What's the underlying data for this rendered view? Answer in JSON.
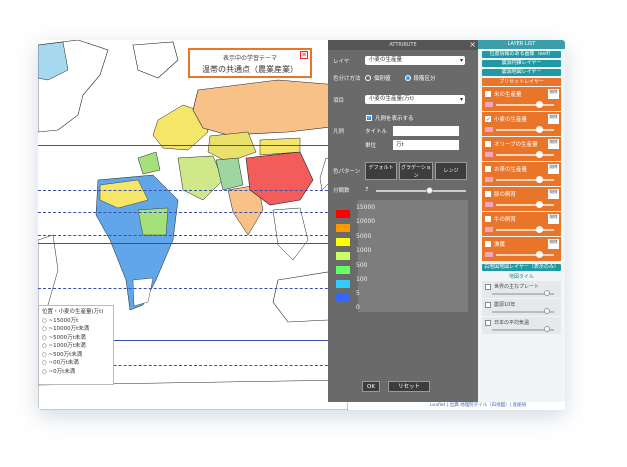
{
  "theme": {
    "heading": "表示中の学習テーマ",
    "title": "温帯の共通点（農業産業）",
    "close_label": "✕"
  },
  "legend_box": {
    "lines": [
      "位置・小麦の生産量(万t)",
      "○ ~15000万t",
      "○ ~10000万t未満",
      "○ ~5000万t未満",
      "○ ~1000万t未満",
      "○ ~500万t未満",
      "○ ~00万t未満",
      "○ ~0万t未満"
    ]
  },
  "settings": {
    "header": "ATTRIBUTE",
    "layer_label": "レイヤ",
    "layer_value": "小麦の生産量",
    "color_method_label": "色分け方法",
    "radio_a": "個別値",
    "radio_b": "段階区分",
    "item_label": "項目",
    "item_value": "小麦の生産量(万t)",
    "legend_check": "凡例を表示する",
    "legend_label": "凡例",
    "title_label": "タイトル",
    "unit_label": "単位",
    "unit_value": "万t",
    "pattern_label": "色パターン",
    "pattern_buttons": [
      "デフォルト",
      "グラデーション",
      "レンジ"
    ],
    "classes_label": "分類数",
    "classes_value": "7",
    "breaks": [
      {
        "color": "#ff0000",
        "value": "15000"
      },
      {
        "color": "#ff9900",
        "value": "10000"
      },
      {
        "color": "#ffff00",
        "value": "5000"
      },
      {
        "color": "#ccff66",
        "value": "1000"
      },
      {
        "color": "#66ff66",
        "value": "500"
      },
      {
        "color": "#33ccff",
        "value": "100"
      },
      {
        "color": "#3366ff",
        "value": "5"
      },
      {
        "color": "",
        "value": "0"
      }
    ],
    "ok": "OK",
    "reset": "リセット"
  },
  "sidebar": {
    "header": "LAYER LIST",
    "buttons": [
      "位置情報のある画像（exif）",
      "震源円錐レイヤー",
      "震源地図レイヤー"
    ],
    "preset_label": "プリセットレイヤー",
    "layers": [
      {
        "name": "米の生産量",
        "checked": false
      },
      {
        "name": "小麦の生産量",
        "checked": true
      },
      {
        "name": "オリーブの生産量",
        "checked": false
      },
      {
        "name": "お茶の生産量",
        "checked": false
      },
      {
        "name": "豚の飼育",
        "checked": false
      },
      {
        "name": "牛の飼育",
        "checked": false
      },
      {
        "name": "漁獲",
        "checked": false
      }
    ],
    "layer_tag": "削除",
    "bottom_title": "白地図地図レイヤー（表示のみ）",
    "tile_label": "地図タイル",
    "tiles": [
      "世界の主なプレート",
      "震源10年",
      "日本の平均気温"
    ]
  },
  "footer": "Leaflet | 出典 地理院タイル（白地図）| 産総研"
}
